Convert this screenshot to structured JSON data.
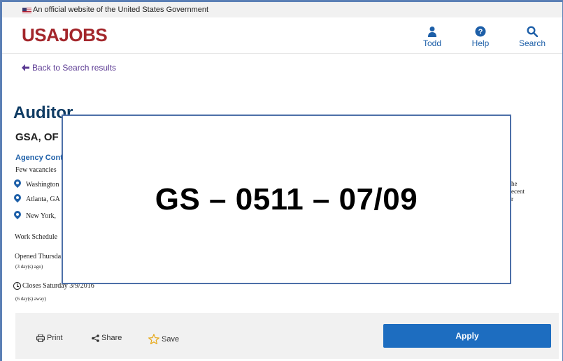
{
  "gov_banner": {
    "text": "An official website of the United States Government"
  },
  "header": {
    "logo": "USAJOBS",
    "nav": [
      {
        "label": "Todd",
        "icon": "user-icon"
      },
      {
        "label": "Help",
        "icon": "help-icon"
      },
      {
        "label": "Search",
        "icon": "search-icon"
      }
    ]
  },
  "back_link": "Back to Search results",
  "job": {
    "title": "Auditor",
    "agency": "GSA, OF",
    "agency_contact": "Agency Conta",
    "vacancies": "Few vacancies",
    "locations": [
      "Washington",
      "Atlanta, GA",
      "New York,"
    ],
    "work_schedule": "Work Schedule",
    "opened": "Opened Thursda",
    "opened_sub": "(3 day(s) ago)",
    "closes": "Closes Saturday 3/9/2016",
    "closes_sub": "(6 day(s) away)",
    "right_snippet": [
      "he",
      "ecent",
      "r"
    ]
  },
  "actions": {
    "print": "Print",
    "share": "Share",
    "save": "Save",
    "apply": "Apply"
  },
  "overlay": {
    "text": "GS – 0511 – 07/09"
  },
  "colors": {
    "brand_red": "#a3262b",
    "link_blue": "#1d5fa8",
    "apply_blue": "#1d6dc0",
    "title_navy": "#0e3b63"
  }
}
